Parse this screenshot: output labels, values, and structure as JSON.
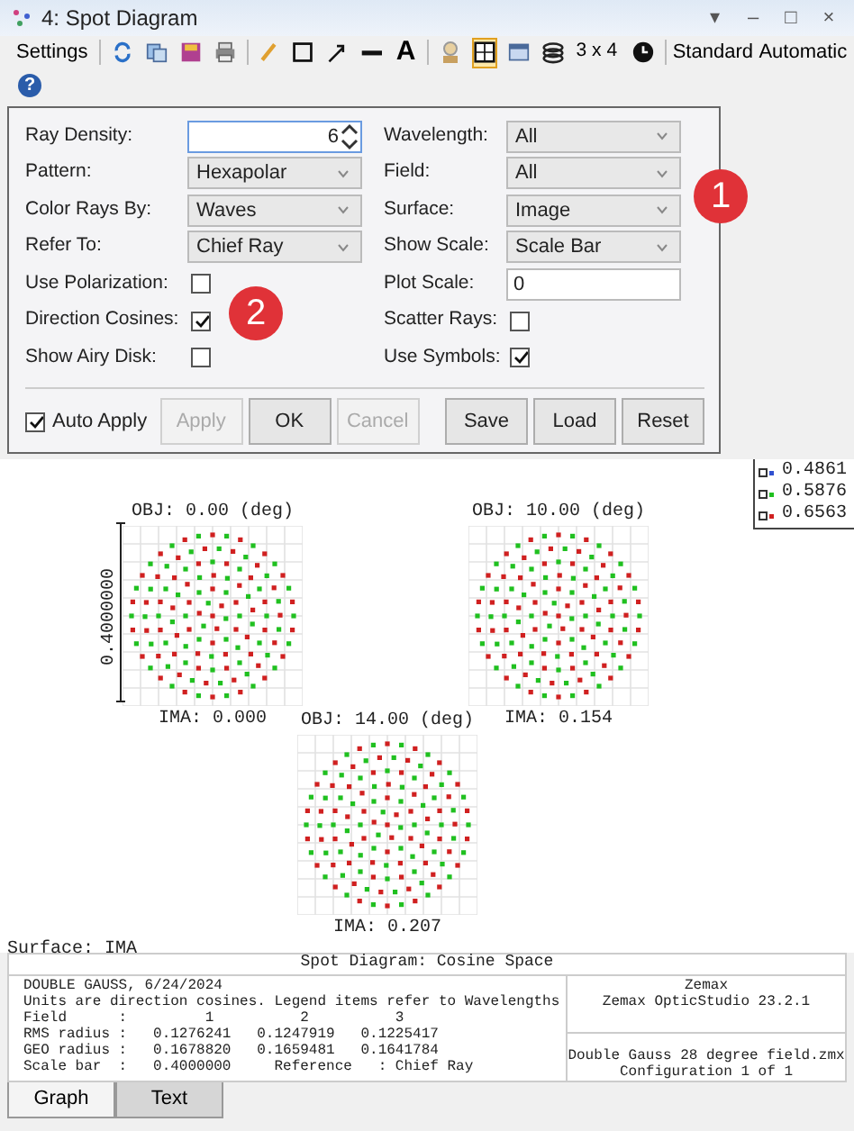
{
  "window": {
    "title": "4: Spot Diagram",
    "controls": [
      "▾",
      "–",
      "□",
      "×"
    ]
  },
  "toolbar": {
    "settings_label": "Settings",
    "text_tool": "A",
    "layout": "3 x 4",
    "dropdowns": [
      "Standard",
      "Automatic"
    ],
    "help": "?"
  },
  "settings": {
    "left": [
      {
        "kind": "spin",
        "label": "Ray Density:",
        "value": "6"
      },
      {
        "kind": "select",
        "label": "Pattern:",
        "value": "Hexapolar"
      },
      {
        "kind": "select",
        "label": "Color Rays By:",
        "value": "Waves"
      },
      {
        "kind": "select",
        "label": "Refer To:",
        "value": "Chief Ray"
      },
      {
        "kind": "check",
        "label": "Use Polarization:",
        "checked": false
      },
      {
        "kind": "check",
        "label": "Direction Cosines:",
        "checked": true
      },
      {
        "kind": "check",
        "label": "Show Airy Disk:",
        "checked": false
      }
    ],
    "right": [
      {
        "kind": "select",
        "label": "Wavelength:",
        "value": "All"
      },
      {
        "kind": "select",
        "label": "Field:",
        "value": "All"
      },
      {
        "kind": "select",
        "label": "Surface:",
        "value": "Image"
      },
      {
        "kind": "select",
        "label": "Show Scale:",
        "value": "Scale Bar"
      },
      {
        "kind": "text",
        "label": "Plot Scale:",
        "value": "0"
      },
      {
        "kind": "check",
        "label": "Scatter Rays:",
        "checked": false
      },
      {
        "kind": "check",
        "label": "Use Symbols:",
        "checked": true
      }
    ],
    "auto_apply": {
      "label": "Auto Apply",
      "checked": true
    },
    "buttons": [
      {
        "label": "Apply",
        "disabled": true
      },
      {
        "label": "OK",
        "disabled": false
      },
      {
        "label": "Cancel",
        "disabled": true
      }
    ],
    "file_buttons": [
      "Save",
      "Load",
      "Reset"
    ]
  },
  "callouts": [
    "1",
    "2"
  ],
  "legend": [
    {
      "label": "0.4861",
      "color": "#3050d0"
    },
    {
      "label": "0.5876",
      "color": "#20c020"
    },
    {
      "label": "0.6563",
      "color": "#d02020"
    }
  ],
  "plots": [
    {
      "title": "OBJ: 0.00 (deg)",
      "caption": "IMA: 0.000"
    },
    {
      "title": "OBJ: 10.00 (deg)",
      "caption": "IMA: 0.154"
    },
    {
      "title": "OBJ: 14.00 (deg)",
      "caption": "IMA: 0.207"
    }
  ],
  "scale_bar": "0.4000000",
  "surface": "Surface: IMA",
  "footer": {
    "title": "Spot Diagram: Cosine Space",
    "lines": [
      "DOUBLE GAUSS, 6/24/2024",
      "Units are direction cosines. Legend items refer to Wavelengths",
      "Field      :         1          2          3",
      "RMS radius :   0.1276241   0.1247919   0.1225417",
      "GEO radius :   0.1678820   0.1659481   0.1641784",
      "Scale bar  :   0.4000000     Reference   : Chief Ray"
    ],
    "right_top": [
      "Zemax",
      "Zemax OpticStudio 23.2.1"
    ],
    "right_bottom": [
      "Double Gauss 28 degree field.zmx",
      "Configuration 1 of 1"
    ]
  },
  "tabs": [
    {
      "label": "Graph",
      "selected": true
    },
    {
      "label": "Text",
      "selected": false
    }
  ]
}
